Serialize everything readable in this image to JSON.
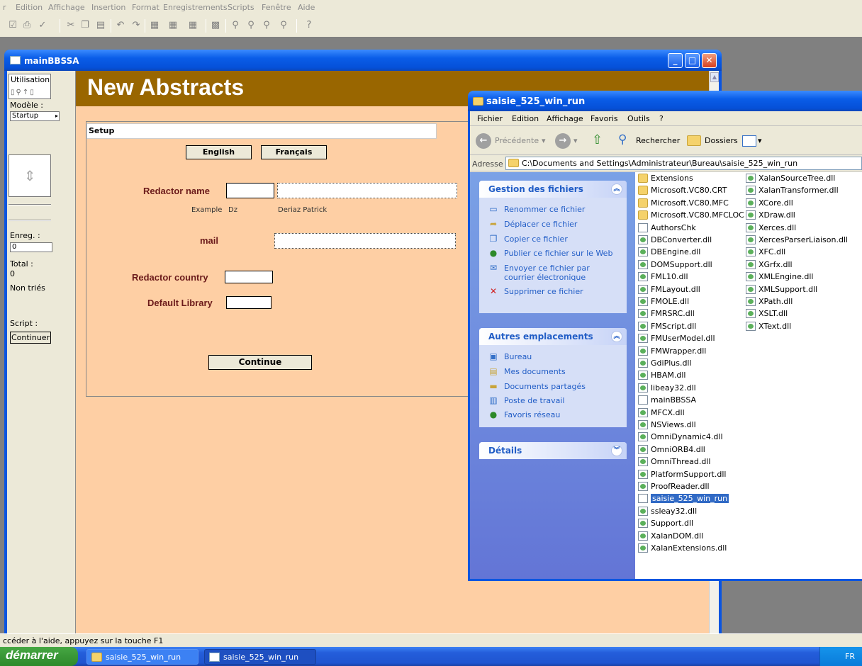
{
  "app_menu": [
    "r",
    "Edition",
    "Affichage",
    "Insertion",
    "Format",
    "Enregistrements",
    "Scripts",
    "Fenêtre",
    "Aide"
  ],
  "fm_window": {
    "title": "mainBBSSA",
    "status_area": {
      "utilisation": "Utilisation",
      "modele_label": "Modèle :",
      "modele_value": "Startup",
      "enreg_label": "Enreg. :",
      "enreg_value": "0",
      "total_label": "Total :",
      "total_value": "0",
      "non_tries": "Non triés",
      "script_label": "Script :",
      "continuer": "Continuer"
    },
    "header_title": "New Abstracts",
    "setup": {
      "bar_label": "Setup",
      "english": "English",
      "francais": "Français",
      "redactor_name": "Redactor name",
      "example": "Example",
      "example_short": "Dz",
      "example_full": "Deriaz Patrick",
      "mail": "mail",
      "redactor_country": "Redactor country",
      "default_library": "Default Library",
      "continue": "Continue"
    }
  },
  "explorer": {
    "title": "saisie_525_win_run",
    "menu": [
      "Fichier",
      "Edition",
      "Affichage",
      "Favoris",
      "Outils",
      "?"
    ],
    "toolbar": {
      "back": "Précédente",
      "search": "Rechercher",
      "folders": "Dossiers"
    },
    "address_label": "Adresse",
    "address": "C:\\Documents and Settings\\Administrateur\\Bureau\\saisie_525_win_run",
    "panels": {
      "file_tasks": {
        "title": "Gestion des fichiers",
        "items": [
          "Renommer ce fichier",
          "Déplacer ce fichier",
          "Copier ce fichier",
          "Publier ce fichier sur le Web",
          "Envoyer ce fichier par courrier électronique",
          "Supprimer ce fichier"
        ]
      },
      "other_places": {
        "title": "Autres emplacements",
        "items": [
          "Bureau",
          "Mes documents",
          "Documents partagés",
          "Poste de travail",
          "Favoris réseau"
        ]
      },
      "details": {
        "title": "Détails"
      }
    },
    "files_col1": [
      {
        "name": "Extensions",
        "type": "folder"
      },
      {
        "name": "Microsoft.VC80.CRT",
        "type": "folder"
      },
      {
        "name": "Microsoft.VC80.MFC",
        "type": "folder"
      },
      {
        "name": "Microsoft.VC80.MFCLOC",
        "type": "folder"
      },
      {
        "name": "AuthorsChk",
        "type": "app"
      },
      {
        "name": "DBConverter.dll",
        "type": "dll"
      },
      {
        "name": "DBEngine.dll",
        "type": "dll"
      },
      {
        "name": "DOMSupport.dll",
        "type": "dll"
      },
      {
        "name": "FML10.dll",
        "type": "dll"
      },
      {
        "name": "FMLayout.dll",
        "type": "dll"
      },
      {
        "name": "FMOLE.dll",
        "type": "dll"
      },
      {
        "name": "FMRSRC.dll",
        "type": "dll"
      },
      {
        "name": "FMScript.dll",
        "type": "dll"
      },
      {
        "name": "FMUserModel.dll",
        "type": "dll"
      },
      {
        "name": "FMWrapper.dll",
        "type": "dll"
      },
      {
        "name": "GdiPlus.dll",
        "type": "dll"
      },
      {
        "name": "HBAM.dll",
        "type": "dll"
      },
      {
        "name": "libeay32.dll",
        "type": "dll"
      },
      {
        "name": "mainBBSSA",
        "type": "app"
      },
      {
        "name": "MFCX.dll",
        "type": "dll"
      },
      {
        "name": "NSViews.dll",
        "type": "dll"
      },
      {
        "name": "OmniDynamic4.dll",
        "type": "dll"
      },
      {
        "name": "OmniORB4.dll",
        "type": "dll"
      },
      {
        "name": "OmniThread.dll",
        "type": "dll"
      },
      {
        "name": "PlatformSupport.dll",
        "type": "dll"
      },
      {
        "name": "ProofReader.dll",
        "type": "dll"
      },
      {
        "name": "saisie_525_win_run",
        "type": "app",
        "selected": true
      },
      {
        "name": "ssleay32.dll",
        "type": "dll"
      },
      {
        "name": "Support.dll",
        "type": "dll"
      },
      {
        "name": "XalanDOM.dll",
        "type": "dll"
      },
      {
        "name": "XalanExtensions.dll",
        "type": "dll"
      }
    ],
    "files_col2": [
      {
        "name": "XalanSourceTree.dll",
        "type": "dll"
      },
      {
        "name": "XalanTransformer.dll",
        "type": "dll"
      },
      {
        "name": "XCore.dll",
        "type": "dll"
      },
      {
        "name": "XDraw.dll",
        "type": "dll"
      },
      {
        "name": "Xerces.dll",
        "type": "dll"
      },
      {
        "name": "XercesParserLiaison.dll",
        "type": "dll"
      },
      {
        "name": "XFC.dll",
        "type": "dll"
      },
      {
        "name": "XGrfx.dll",
        "type": "dll"
      },
      {
        "name": "XMLEngine.dll",
        "type": "dll"
      },
      {
        "name": "XMLSupport.dll",
        "type": "dll"
      },
      {
        "name": "XPath.dll",
        "type": "dll"
      },
      {
        "name": "XSLT.dll",
        "type": "dll"
      },
      {
        "name": "XText.dll",
        "type": "dll"
      }
    ]
  },
  "status_bar": "ccéder à l'aide, appuyez sur la touche F1",
  "taskbar": {
    "start": "démarrer",
    "tasks": [
      "saisie_525_win_run",
      "saisie_525_win_run"
    ],
    "lang": "FR"
  },
  "colors": {
    "fm_header": "#996600",
    "fm_background": "#fecfa4",
    "label_maroon": "#6b1a1a",
    "xp_blue": "#0a55e0",
    "selection": "#316ac5"
  }
}
